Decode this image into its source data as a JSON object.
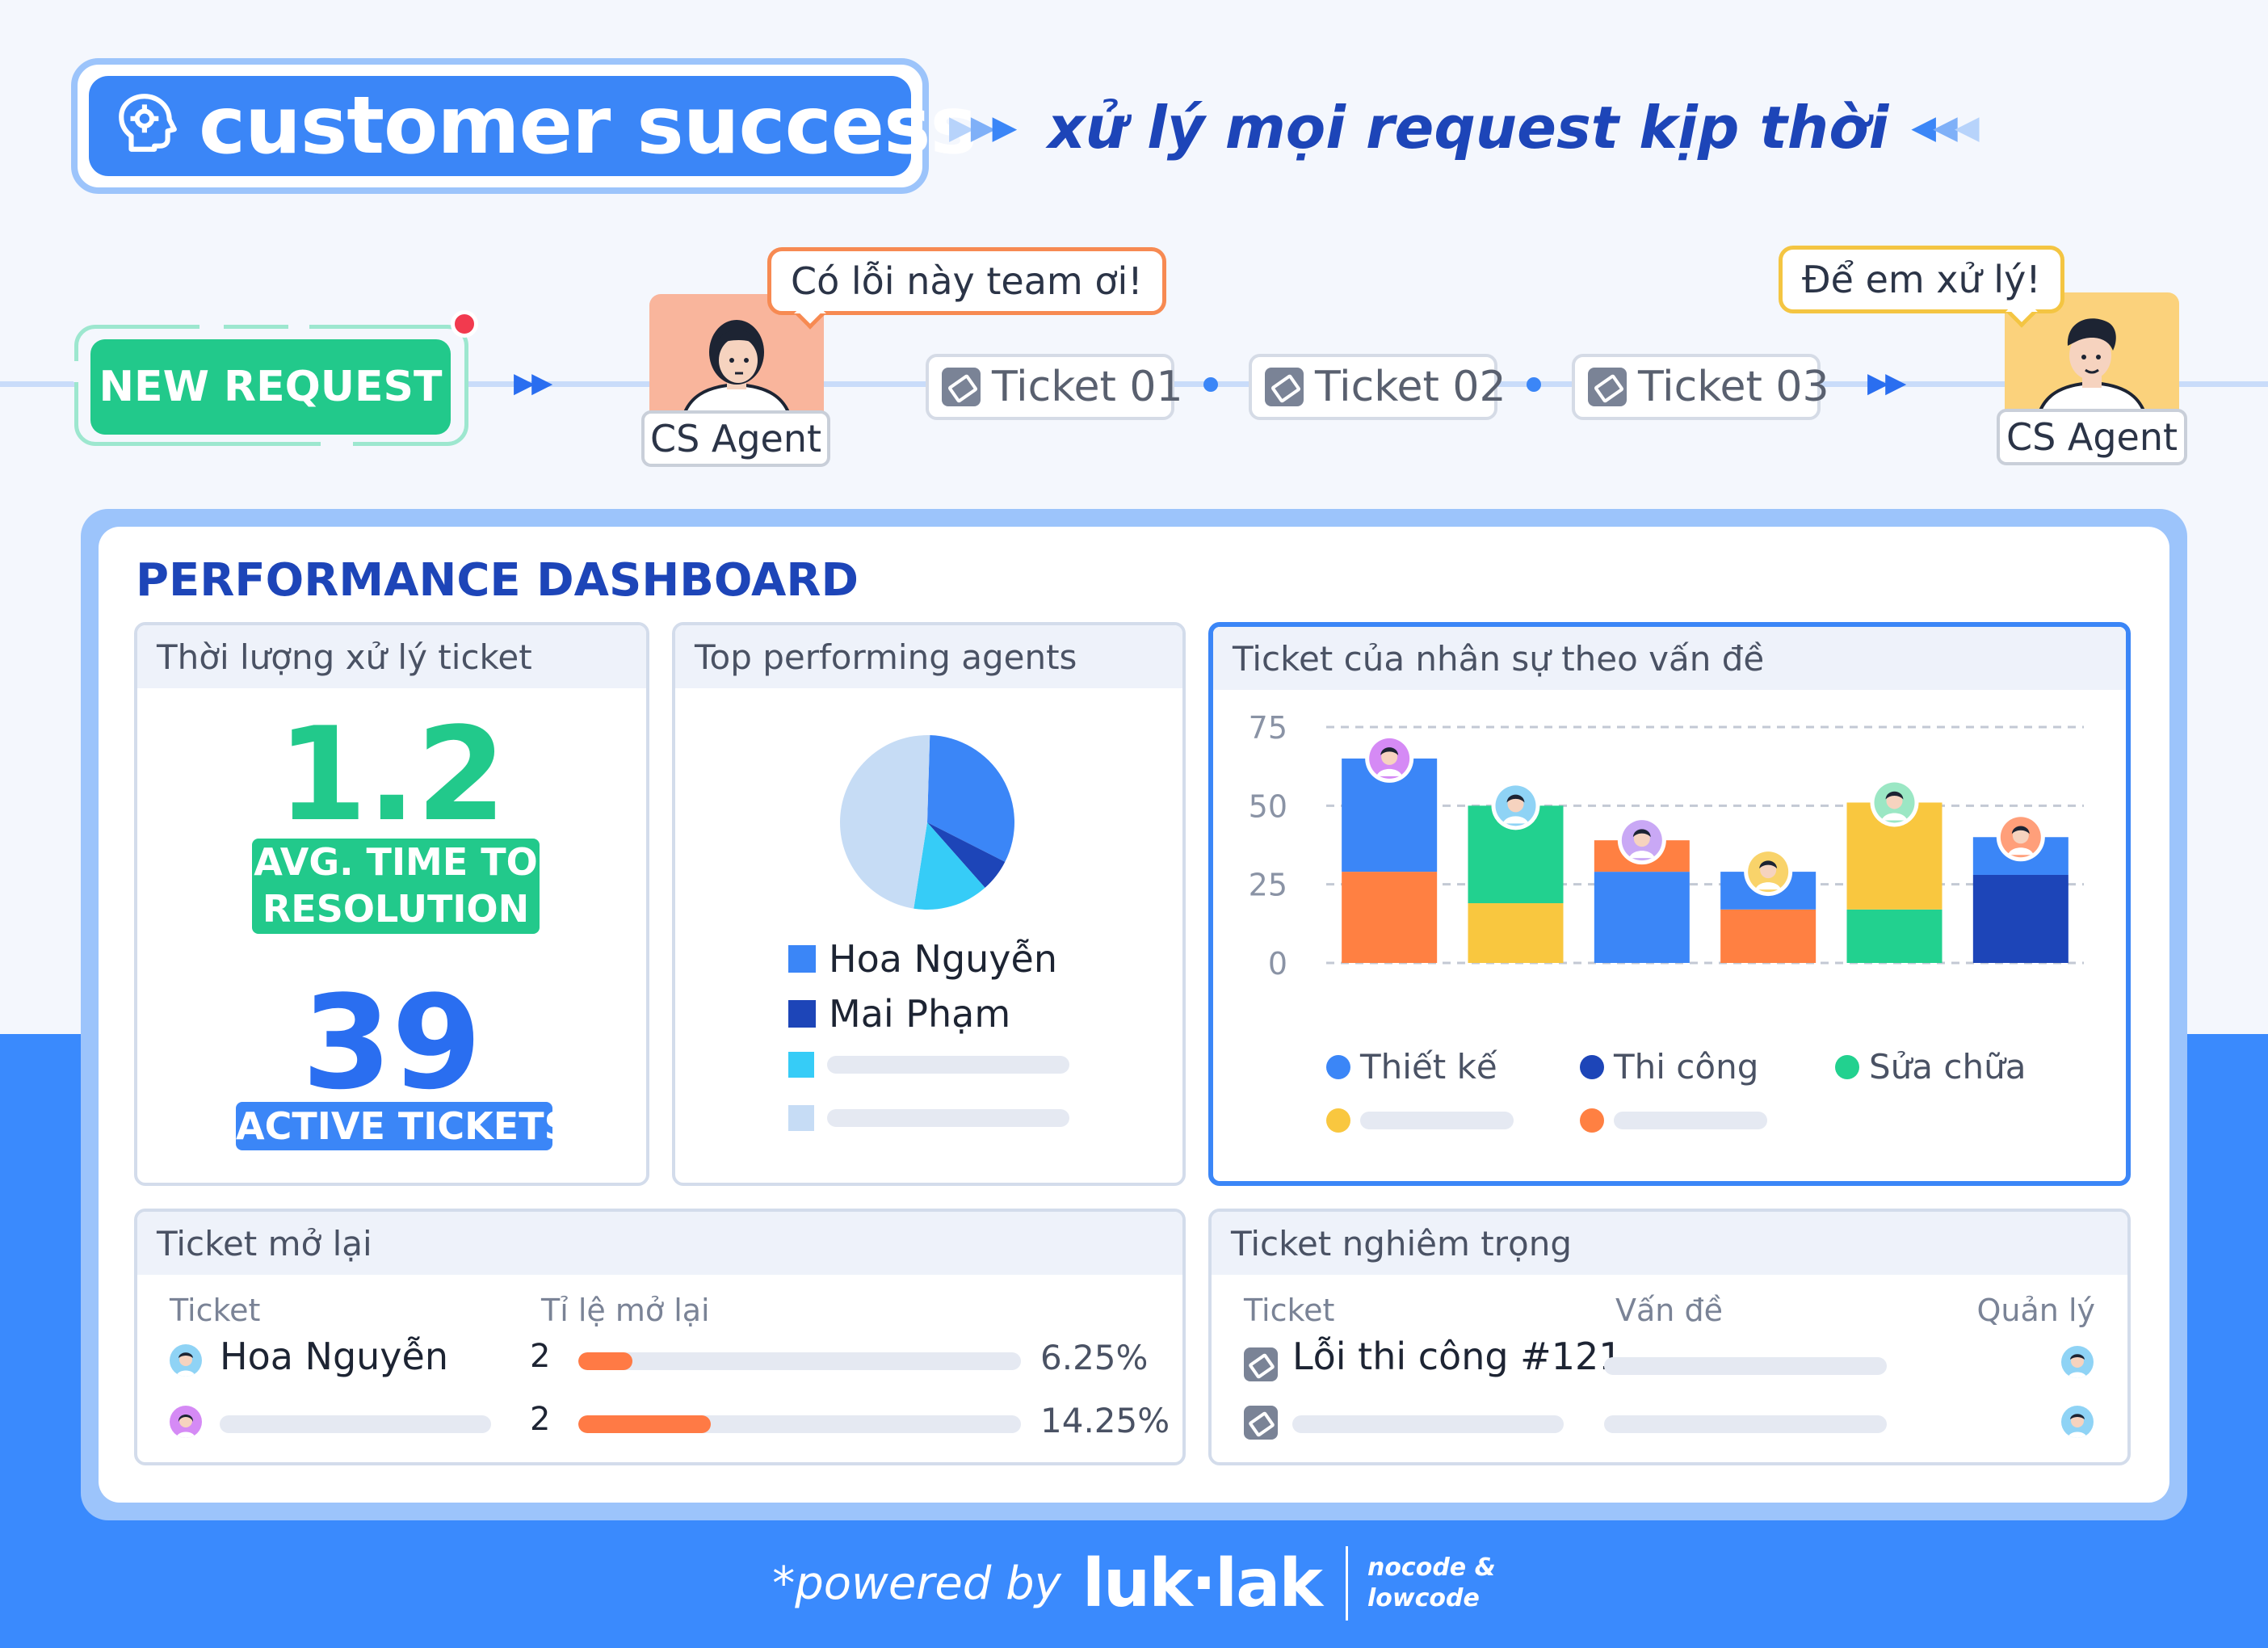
{
  "header": {
    "title": "customer success",
    "tagline": "xử lý mọi request kịp thời"
  },
  "flow": {
    "new_request": "NEW REQUEST",
    "agent_left_label": "CS Agent",
    "agent_left_bubble": "Có lỗi này team ơi!",
    "tickets": [
      "Ticket 01",
      "Ticket 02",
      "Ticket 03"
    ],
    "agent_right_label": "CS Agent",
    "agent_right_bubble": "Để em xử lý!"
  },
  "dashboard": {
    "title": "PERFORMANCE DASHBOARD",
    "resolution_panel": {
      "title": "Thời lượng xử lý ticket",
      "avg_time": "1.2",
      "avg_label_1": "AVG. TIME TO",
      "avg_label_2": "RESOLUTION",
      "active_count": "39",
      "active_label": "ACTIVE TICKETS"
    },
    "agents_panel": {
      "title": "Top performing agents",
      "legend": [
        "Hoa Nguyễn",
        "Mai Phạm"
      ]
    },
    "issues_panel": {
      "title": "Ticket của nhân sự theo vấn đề",
      "legend": [
        "Thiết kế",
        "Thi công",
        "Sửa chữa"
      ]
    },
    "reopened_panel": {
      "title": "Ticket mở lại",
      "col_ticket": "Ticket",
      "col_rate": "Tỉ lệ mở lại",
      "rows": [
        {
          "name": "Hoa Nguyễn",
          "count": "2",
          "rate": "6.25%",
          "fill": 0.1225
        },
        {
          "name": "",
          "count": "2",
          "rate": "14.25%",
          "fill": 0.3
        }
      ]
    },
    "critical_panel": {
      "title": "Ticket nghiêm trọng",
      "col_ticket": "Ticket",
      "col_issue": "Vấn đề",
      "col_manager": "Quản lý",
      "rows": [
        {
          "ticket": "Lỗi thi công #121"
        },
        {
          "ticket": ""
        }
      ]
    }
  },
  "chart_data": [
    {
      "type": "pie",
      "title": "Top performing agents",
      "labels": [
        "Hoa Nguyễn",
        "Mai Phạm",
        "",
        ""
      ],
      "values": [
        32,
        6,
        14,
        48
      ],
      "colors": [
        "#3b86f7",
        "#1d45b8",
        "#36ccf7",
        "#c6dcf5"
      ]
    },
    {
      "type": "bar",
      "stacked": true,
      "title": "Ticket của nhân sự theo vấn đề",
      "ylim": [
        0,
        75
      ],
      "yticks": [
        0,
        25,
        50,
        75
      ],
      "grid": true,
      "categories": [
        "",
        "",
        "",
        "",
        "",
        ""
      ],
      "bars": [
        {
          "segments": [
            {
              "value": 29,
              "color": "#ff8042"
            },
            {
              "value": 36,
              "color": "#3b86f7"
            }
          ]
        },
        {
          "segments": [
            {
              "value": 19,
              "color": "#f9c73f"
            },
            {
              "value": 31,
              "color": "#22d18f"
            }
          ]
        },
        {
          "segments": [
            {
              "value": 29,
              "color": "#3b86f7"
            },
            {
              "value": 10,
              "color": "#ff8042"
            }
          ]
        },
        {
          "segments": [
            {
              "value": 17,
              "color": "#ff8042"
            },
            {
              "value": 12,
              "color": "#3b86f7"
            }
          ]
        },
        {
          "segments": [
            {
              "value": 17,
              "color": "#22d18f"
            },
            {
              "value": 34,
              "color": "#f9c73f"
            }
          ]
        },
        {
          "segments": [
            {
              "value": 28,
              "color": "#1d45b8"
            },
            {
              "value": 12,
              "color": "#3b86f7"
            }
          ]
        }
      ],
      "legend": [
        {
          "name": "Thiết kế",
          "color": "#3b86f7"
        },
        {
          "name": "Thi công",
          "color": "#1d45b8"
        },
        {
          "name": "Sửa chữa",
          "color": "#22d18f"
        },
        {
          "name": "",
          "color": "#f9c73f"
        },
        {
          "name": "",
          "color": "#ff8042"
        }
      ]
    }
  ],
  "footer": {
    "powered_by": "*powered by",
    "brand": "luk·lak",
    "brand_sub_1": "nocode &",
    "brand_sub_2": "lowcode"
  }
}
